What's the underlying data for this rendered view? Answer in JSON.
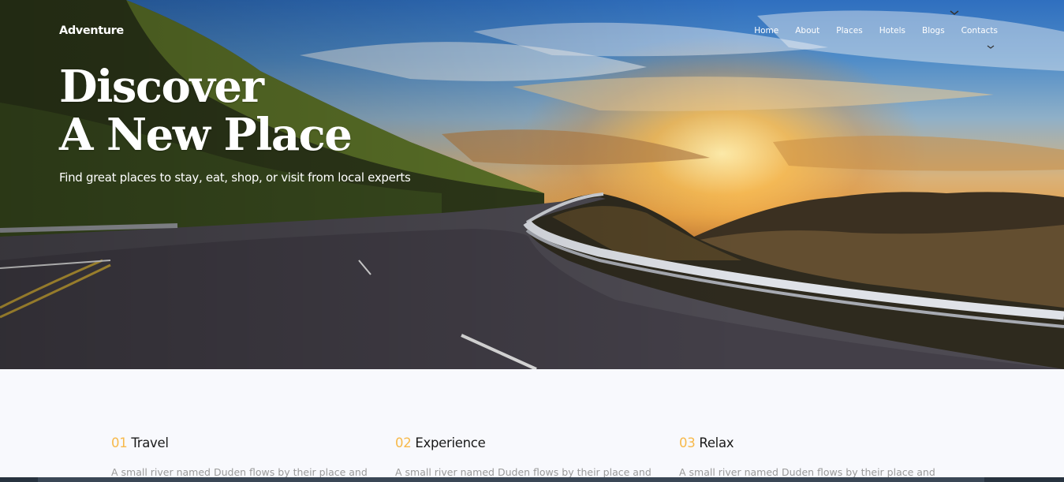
{
  "navbar": {
    "brand": "Adventure",
    "items": [
      "Home",
      "About",
      "Places",
      "Hotels",
      "Blogs",
      "Contacts"
    ]
  },
  "hero": {
    "title_line1": "Discover",
    "title_line2": "A New Place",
    "subtitle": "Find great places to stay, eat, shop, or visit from local experts"
  },
  "features": [
    {
      "number": "01",
      "title": "Travel",
      "description": "A small river named Duden flows by their place and"
    },
    {
      "number": "02",
      "title": "Experience",
      "description": "A small river named Duden flows by their place and"
    },
    {
      "number": "03",
      "title": "Relax",
      "description": "A small river named Duden flows by their place and"
    }
  ],
  "colors": {
    "accent": "#f7b94a",
    "section_background": "#f8f9fd",
    "heading_text": "#1a1a1a",
    "body_text": "#9a9a9a"
  }
}
